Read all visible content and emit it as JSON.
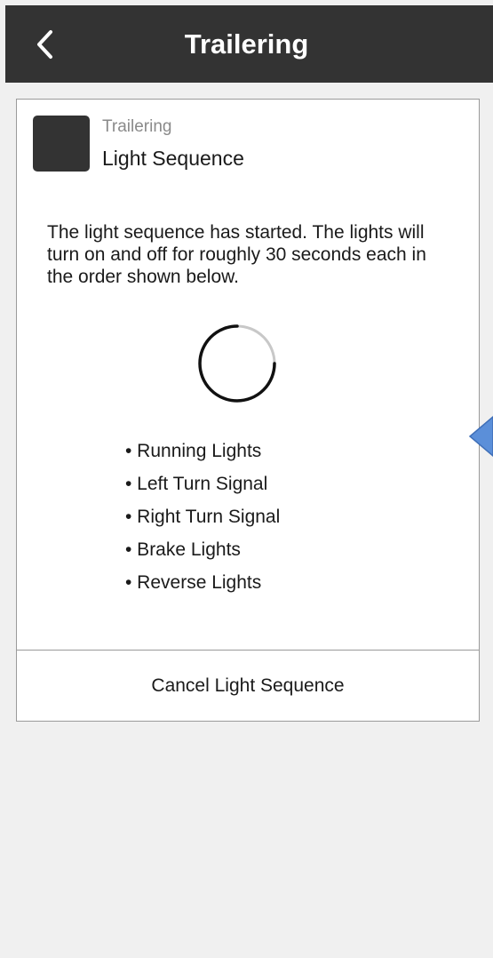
{
  "header": {
    "title": "Trailering",
    "background_color": "#333333",
    "back_icon": "chevron-left-icon"
  },
  "card": {
    "app_name": "Trailering",
    "title": "Light Sequence",
    "description": "The light sequence has started. The lights will turn on and off for roughly 30 seconds each in the order shown below.",
    "sequence": [
      "• Running Lights",
      "• Left Turn Signal",
      "• Right Turn Signal",
      "• Brake Lights",
      "• Reverse Lights"
    ],
    "cancel_label": "Cancel Light Sequence"
  },
  "colors": {
    "page_background": "#f0f0f0",
    "icon_tile": "#333333",
    "pointer_accent": "#5b8fd9"
  }
}
